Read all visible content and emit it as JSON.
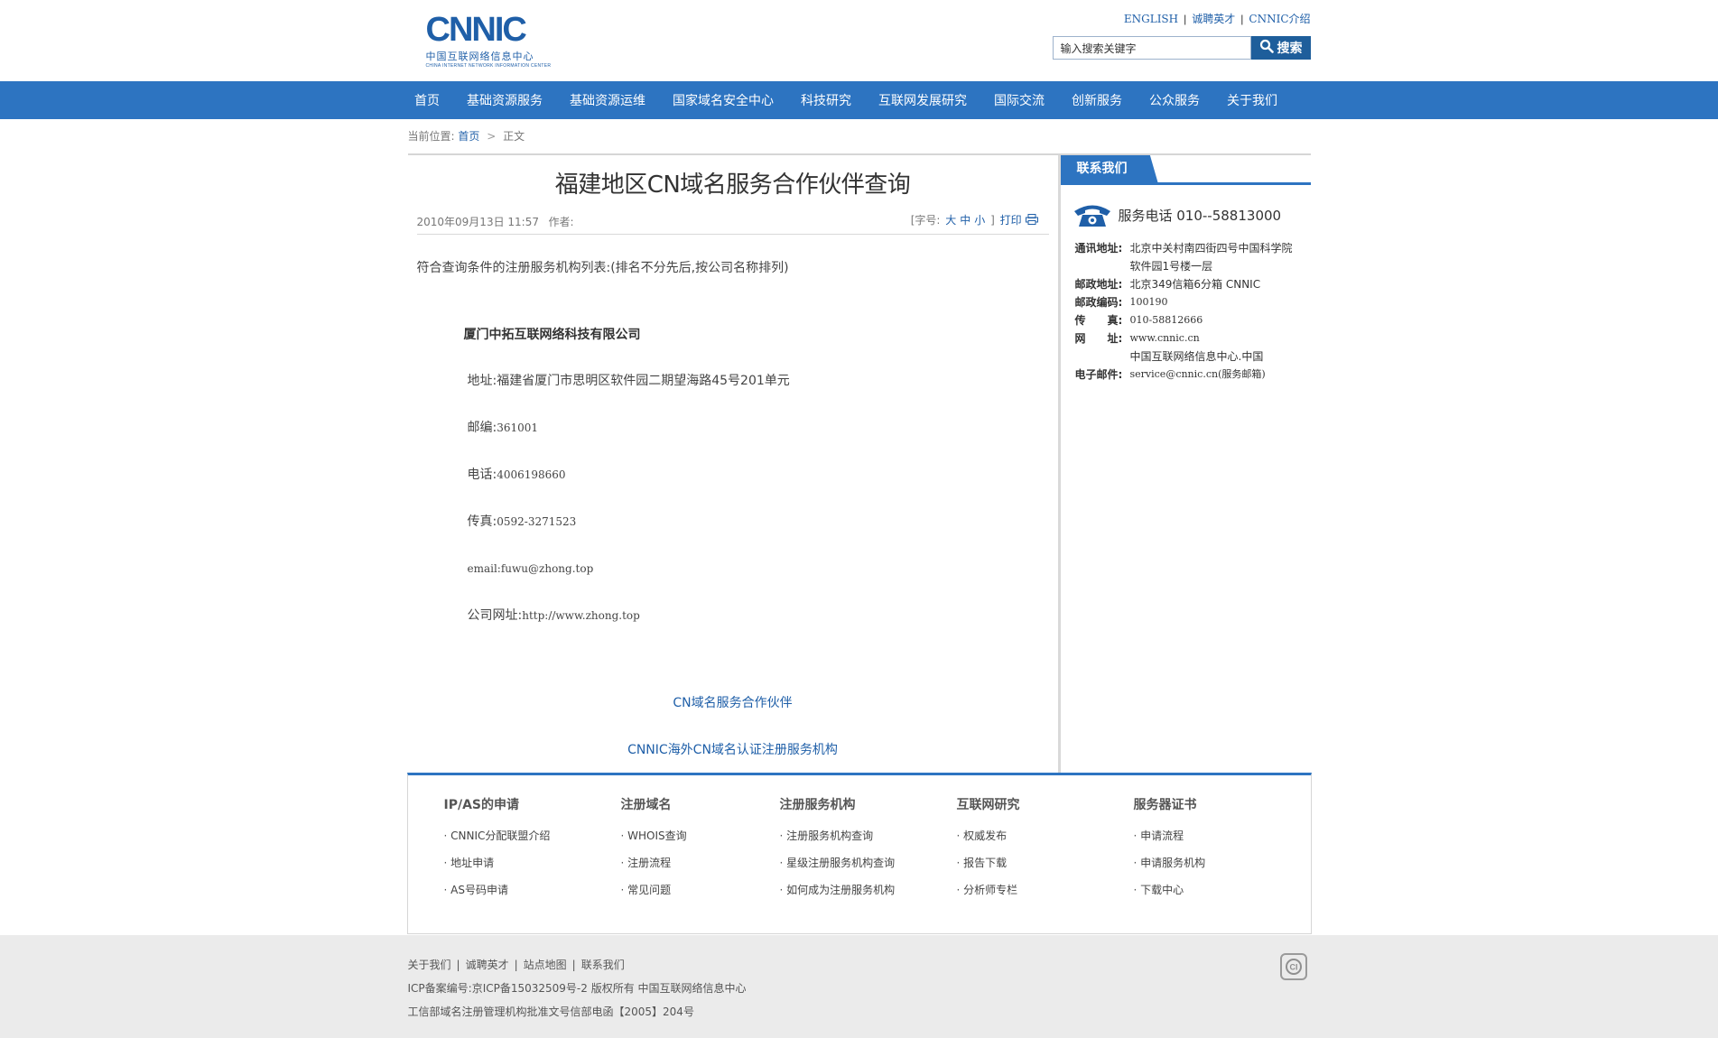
{
  "brand": {
    "logo_main": "CNNIC",
    "logo_cn": "中国互联网络信息中心",
    "logo_en": "CHINA INTERNET NETWORK INFORMATION CENTER",
    "accent": "#2d74c1"
  },
  "toplinks": {
    "english": "ENGLISH",
    "jobs": "诚聘英才",
    "about": "CNNIC介绍",
    "sep": "|"
  },
  "search": {
    "placeholder": "输入搜索关键字",
    "value": "输入搜索关键字",
    "button_label": "搜索"
  },
  "nav": {
    "items": [
      "首页",
      "基础资源服务",
      "基础资源运维",
      "国家域名安全中心",
      "科技研究",
      "互联网发展研究",
      "国际交流",
      "创新服务",
      "公众服务",
      "关于我们"
    ]
  },
  "breadcrumb": {
    "prefix": "当前位置:",
    "home": "首页",
    "current": "正文"
  },
  "article": {
    "title": "福建地区CN域名服务合作伙伴查询",
    "date": "2010年09月13日 11:57",
    "author": "作者:",
    "font_label_open": "[字号:",
    "font_large": "大",
    "font_medium": "中",
    "font_small": "小",
    "font_label_close": "]",
    "print": "打印",
    "intro": "符合查询条件的注册服务机构列表:(排名不分先后,按公司名称排列)",
    "company": "厦门中拓互联网络科技有限公司",
    "address_label": "地址:",
    "address": "福建省厦门市思明区软件园二期望海路45号201单元",
    "zip_label": "邮编:",
    "zip": "361001",
    "phone_label": "电话:",
    "phone": "4006198660",
    "fax_label": "传真:",
    "fax": "0592-3271523",
    "email_label": "email:",
    "email": "fuwu@zhong.top",
    "site_label": "公司网址:",
    "site": "http://www.zhong.top",
    "link1": "CN域名服务合作伙伴",
    "link2": "CNNIC海外CN域名认证注册服务机构"
  },
  "sidebar": {
    "title": "联系我们",
    "phone_text": "服务电话 010--58813000",
    "rows": [
      {
        "label": "通讯地址:",
        "value": "北京中关村南四街四号中国科学院"
      },
      {
        "label": "",
        "value": "软件园1号楼一层"
      },
      {
        "label": "邮政地址:",
        "value": "北京349信箱6分箱 CNNIC"
      },
      {
        "label": "邮政编码:",
        "value": "100190"
      },
      {
        "label": "传　　真:",
        "value": "010-58812666"
      },
      {
        "label": "网　　址:",
        "value": "www.cnnic.cn"
      },
      {
        "label": "",
        "value": "中国互联网络信息中心.中国"
      },
      {
        "label": "电子邮件:",
        "value": "service@cnnic.cn(服务邮箱)"
      }
    ]
  },
  "footer_links": {
    "columns": [
      {
        "title": "IP/AS的申请",
        "items": [
          "CNNIC分配联盟介绍",
          "地址申请",
          "AS号码申请"
        ]
      },
      {
        "title": "注册域名",
        "items": [
          "WHOIS查询",
          "注册流程",
          "常见问题"
        ]
      },
      {
        "title": "注册服务机构",
        "items": [
          "注册服务机构查询",
          "星级注册服务机构查询",
          "如何成为注册服务机构"
        ]
      },
      {
        "title": "互联网研究",
        "items": [
          "权威发布",
          "报告下载",
          "分析师专栏"
        ]
      },
      {
        "title": "服务器证书",
        "items": [
          "申请流程",
          "申请服务机构",
          "下载中心"
        ]
      }
    ]
  },
  "footer": {
    "links": [
      "关于我们",
      "诚聘英才",
      "站点地图",
      "联系我们"
    ],
    "icp": "ICP备案编号:京ICP备15032509号-2  版权所有  中国互联网络信息中心",
    "license": "工信部域名注册管理机构批准文号信部电函【2005】204号",
    "seal_text": "CI"
  }
}
